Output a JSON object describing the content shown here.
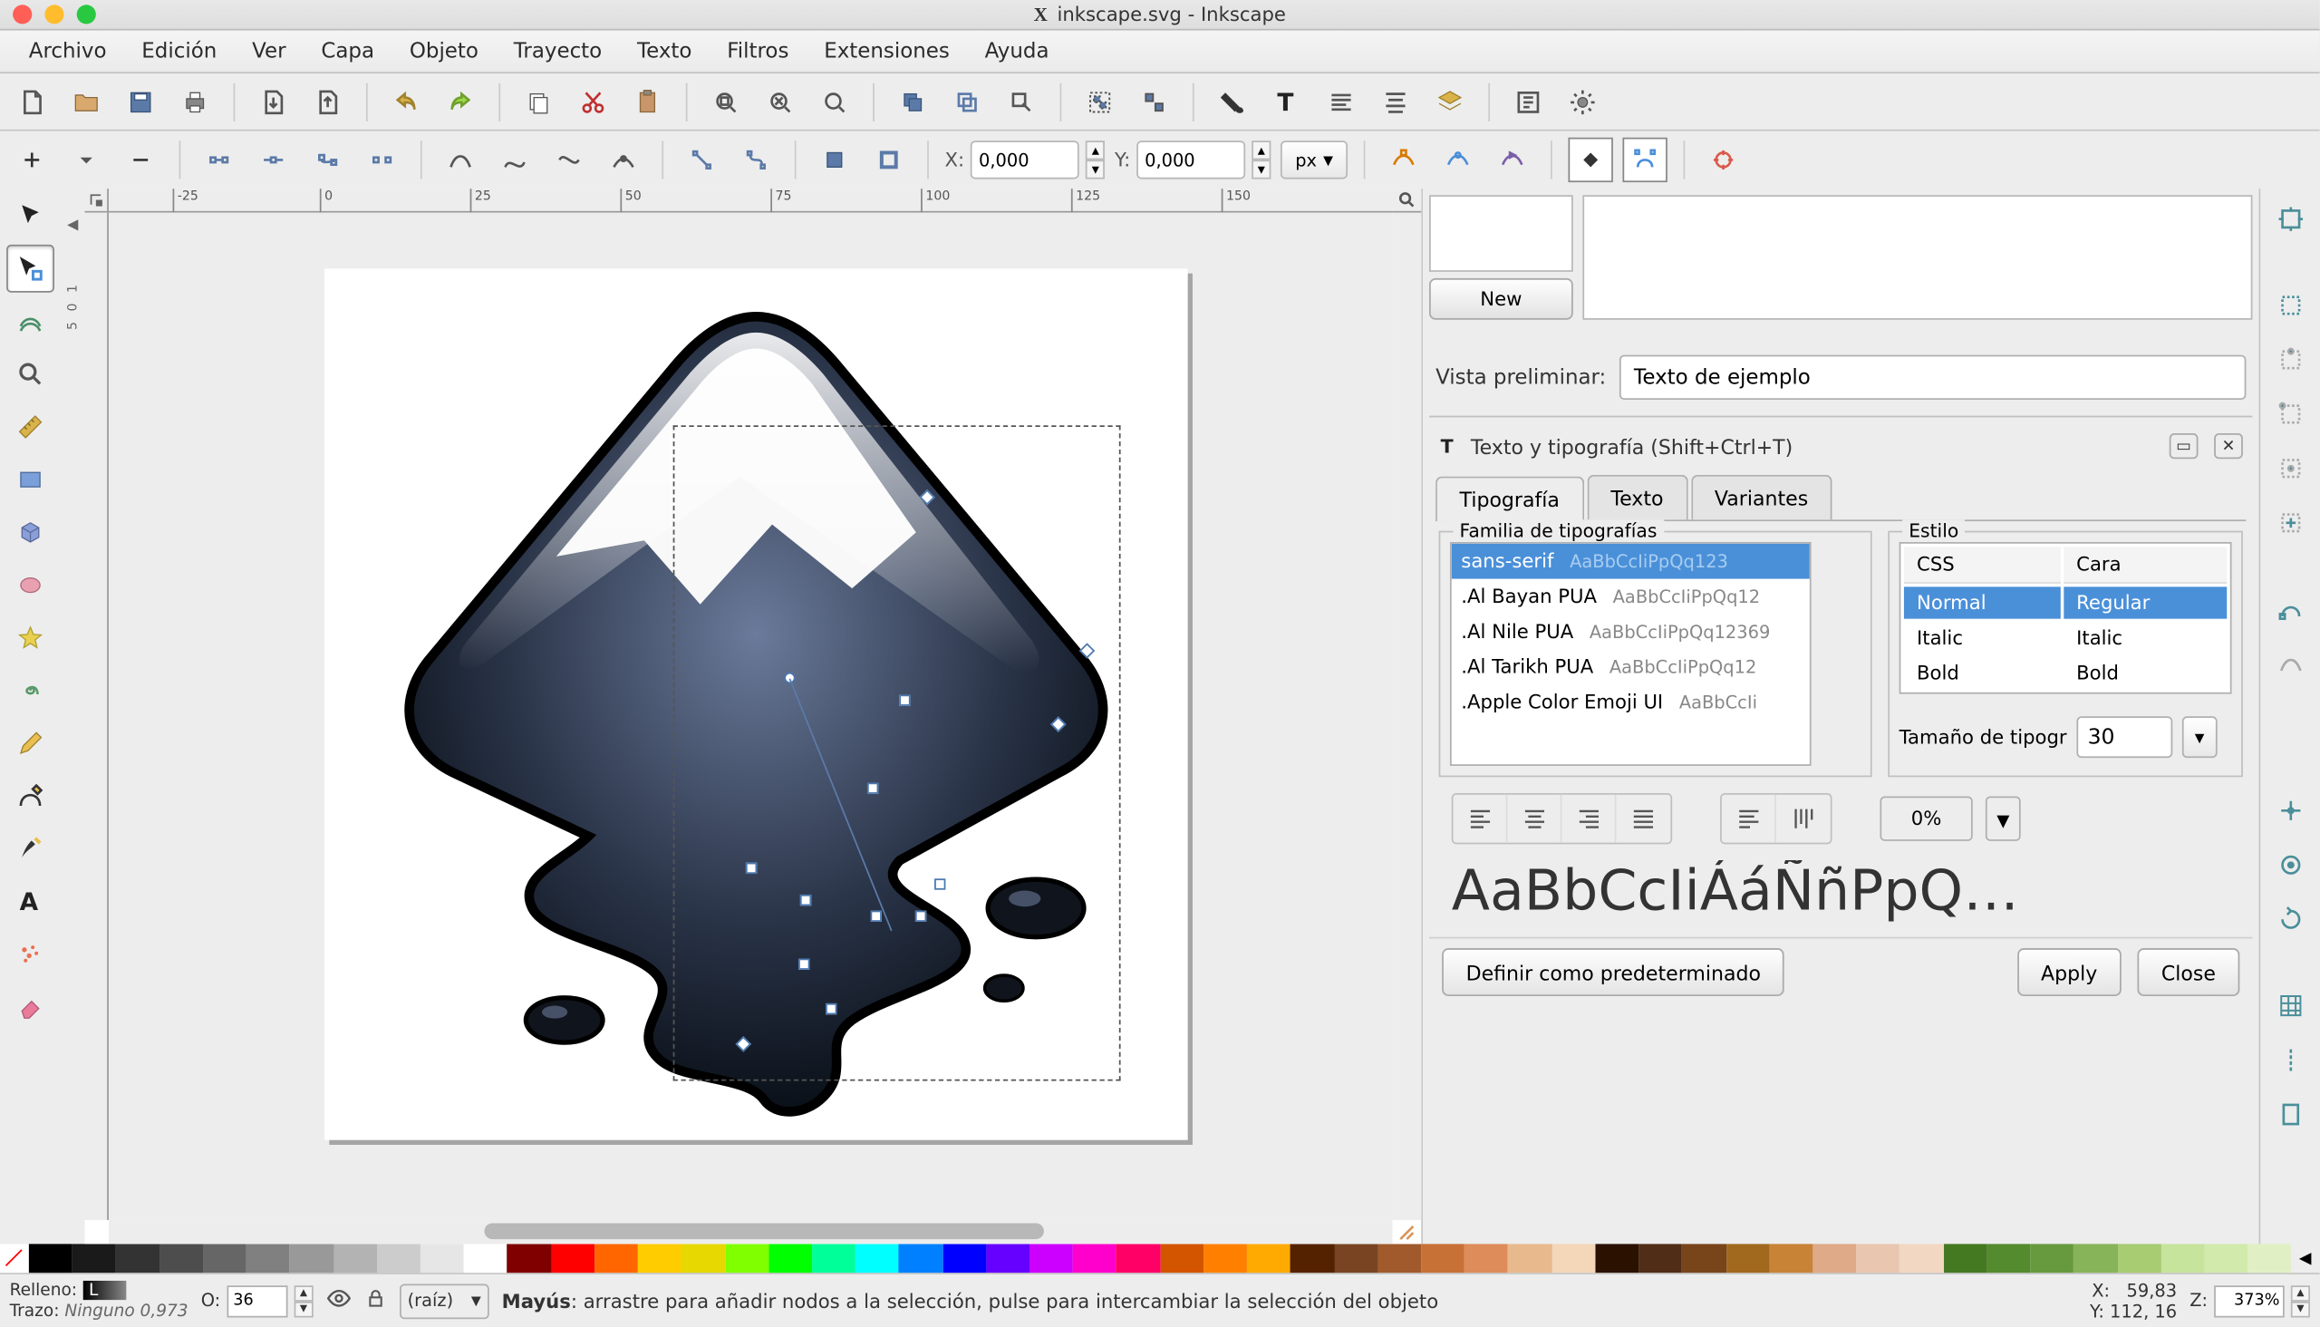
{
  "title": "inkscape.svg - Inkscape",
  "menu": [
    "Archivo",
    "Edición",
    "Ver",
    "Capa",
    "Objeto",
    "Trayecto",
    "Texto",
    "Filtros",
    "Extensiones",
    "Ayuda"
  ],
  "coords": {
    "x_label": "X:",
    "x_value": "0,000",
    "y_label": "Y:",
    "y_value": "0,000",
    "unit": "px"
  },
  "dock": {
    "new_btn": "New",
    "preview_label": "Vista preliminar:",
    "preview_value": "Texto de ejemplo",
    "panel_title": "Texto y tipografía (Shift+Ctrl+T)",
    "tabs": [
      "Tipografía",
      "Texto",
      "Variantes"
    ],
    "fontfam_label": "Familia de tipografías",
    "style_label": "Estilo",
    "fonts": [
      {
        "name": "sans-serif",
        "sample": "AaBbCcIiPpQq123"
      },
      {
        "name": ".Al Bayan PUA",
        "sample": "AaBbCcIiPpQq12"
      },
      {
        "name": ".Al Nile PUA",
        "sample": "AaBbCcIiPpQq12369"
      },
      {
        "name": ".Al Tarikh PUA",
        "sample": "AaBbCcIiPpQq12"
      },
      {
        "name": ".Apple Color Emoji UI",
        "sample": "AaBbCcIi"
      }
    ],
    "style_cols": [
      "CSS",
      "Cara"
    ],
    "styles": [
      {
        "css": "Normal",
        "face": "Regular"
      },
      {
        "css": "Italic",
        "face": "Italic"
      },
      {
        "css": "Bold",
        "face": "Bold"
      }
    ],
    "size_label": "Tamaño de tipogr",
    "size_value": "30",
    "spacing": "0%",
    "preview": "AaBbCcIiÁáÑñPpQ…",
    "default_btn": "Definir como predeterminado",
    "apply_btn": "Apply",
    "close_btn": "Close"
  },
  "status": {
    "fill_label": "Relleno:",
    "fill_value": "L",
    "stroke_label": "Trazo:",
    "stroke_value": "Ninguno 0,973",
    "o_label": "O:",
    "o_value": "36",
    "layer": "(raíz)",
    "hint_bold": "Mayús",
    "hint_rest": ": arrastre para añadir nodos a la selección, pulse para intercambiar la selección del objeto",
    "cx_label": "X:",
    "cx": "59,83",
    "cy_label": "Y:",
    "cy": "112, 16",
    "z_label": "Z:",
    "z": "373%"
  },
  "palette": [
    "#000000",
    "#1a1a1a",
    "#333333",
    "#4d4d4d",
    "#666666",
    "#808080",
    "#999999",
    "#b3b3b3",
    "#cccccc",
    "#e6e6e6",
    "#ffffff",
    "#800000",
    "#ff0000",
    "#ff6600",
    "#ffcc00",
    "#e6d800",
    "#80ff00",
    "#00ff00",
    "#00ff99",
    "#00ffff",
    "#0080ff",
    "#0000ff",
    "#6600ff",
    "#cc00ff",
    "#ff00cc",
    "#ff0066",
    "#d45500",
    "#ff8000",
    "#ffaa00",
    "#552200",
    "#784421",
    "#a05a2c",
    "#c87137",
    "#de8c5a",
    "#e9b98e",
    "#f4d7b8",
    "#2b1100",
    "#502d16",
    "#78451a",
    "#a0691e",
    "#c88337",
    "#deaa87",
    "#e9c6af",
    "#f2d8c2",
    "#447821",
    "#558b2f",
    "#679a3f",
    "#87b359",
    "#a7cc72",
    "#c6e49c",
    "#d2eaab",
    "#e1f0c4"
  ],
  "ruler_marks": [
    -25,
    0,
    25,
    50,
    75,
    100,
    125,
    150
  ]
}
